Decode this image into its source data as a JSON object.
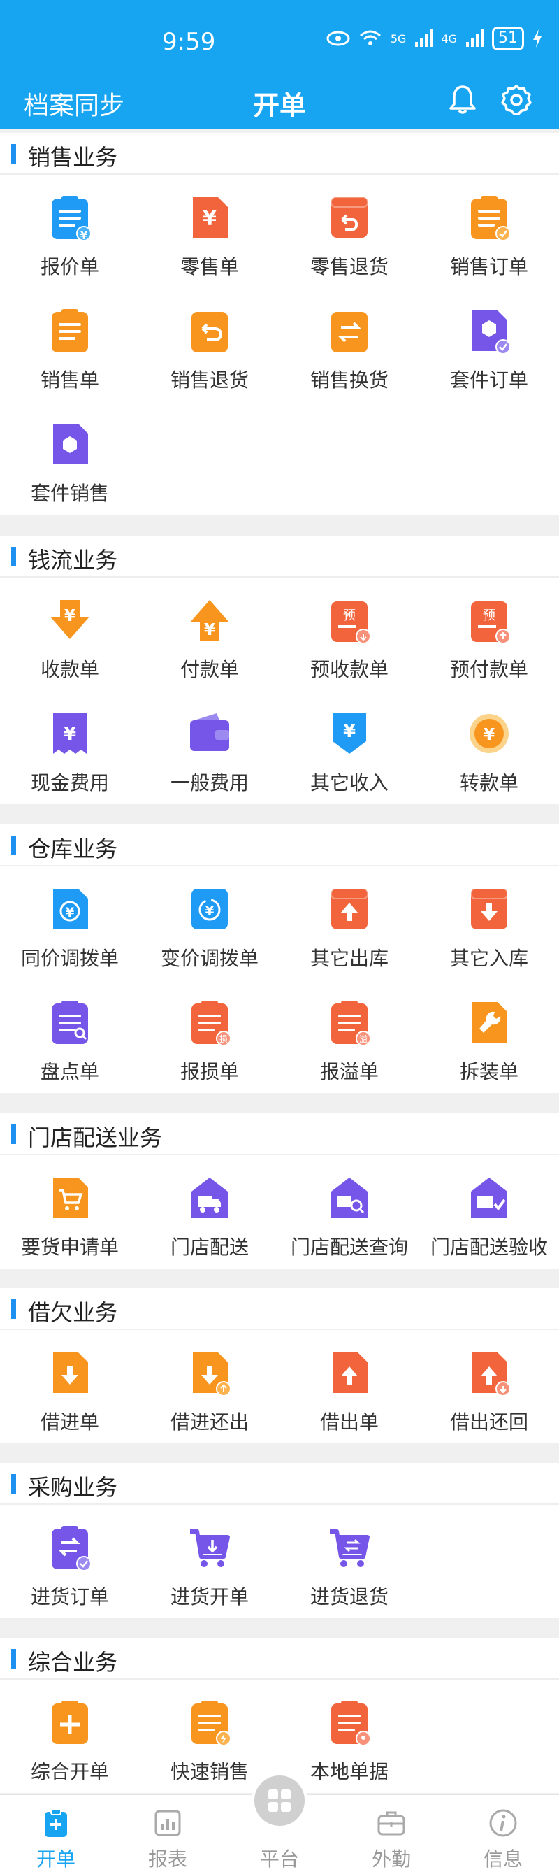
{
  "status": {
    "time": "9:59",
    "battery": "51",
    "net1": "5G",
    "net2": "4G"
  },
  "header": {
    "left_link": "档案同步",
    "title": "开单"
  },
  "colors": {
    "primary": "#17a4f0",
    "orange": "#f7951e",
    "red": "#f2643c",
    "purple": "#7556e8",
    "blue": "#1f9af5"
  },
  "sections": [
    {
      "title": "销售业务",
      "items": [
        {
          "label": "报价单",
          "icon": "quote-doc-icon"
        },
        {
          "label": "零售单",
          "icon": "retail-yen-doc-icon"
        },
        {
          "label": "零售退货",
          "icon": "retail-return-box-icon"
        },
        {
          "label": "销售订单",
          "icon": "sales-order-doc-icon"
        },
        {
          "label": "销售单",
          "icon": "sales-doc-icon"
        },
        {
          "label": "销售退货",
          "icon": "sales-return-icon"
        },
        {
          "label": "销售换货",
          "icon": "sales-exchange-icon"
        },
        {
          "label": "套件订单",
          "icon": "kit-order-icon"
        },
        {
          "label": "套件销售",
          "icon": "kit-sales-icon"
        }
      ]
    },
    {
      "title": "钱流业务",
      "items": [
        {
          "label": "收款单",
          "icon": "receipt-down-arrow-icon"
        },
        {
          "label": "付款单",
          "icon": "payment-up-arrow-icon"
        },
        {
          "label": "预收款单",
          "icon": "advance-receipt-icon"
        },
        {
          "label": "预付款单",
          "icon": "advance-payment-icon"
        },
        {
          "label": "现金费用",
          "icon": "cash-expense-icon"
        },
        {
          "label": "一般费用",
          "icon": "wallet-icon"
        },
        {
          "label": "其它收入",
          "icon": "other-income-icon"
        },
        {
          "label": "转款单",
          "icon": "transfer-coin-icon"
        }
      ]
    },
    {
      "title": "仓库业务",
      "items": [
        {
          "label": "同价调拨单",
          "icon": "same-price-transfer-icon"
        },
        {
          "label": "变价调拨单",
          "icon": "variable-price-transfer-icon"
        },
        {
          "label": "其它出库",
          "icon": "other-outbound-box-icon"
        },
        {
          "label": "其它入库",
          "icon": "other-inbound-box-icon"
        },
        {
          "label": "盘点单",
          "icon": "stocktake-icon"
        },
        {
          "label": "报损单",
          "icon": "loss-report-icon"
        },
        {
          "label": "报溢单",
          "icon": "overflow-report-icon"
        },
        {
          "label": "拆装单",
          "icon": "wrench-icon"
        }
      ]
    },
    {
      "title": "门店配送业务",
      "items": [
        {
          "label": "要货申请单",
          "icon": "cart-request-icon"
        },
        {
          "label": "门店配送",
          "icon": "store-delivery-truck-icon"
        },
        {
          "label": "门店配送查询",
          "icon": "store-delivery-query-icon"
        },
        {
          "label": "门店配送验收",
          "icon": "store-delivery-check-icon"
        }
      ]
    },
    {
      "title": "借欠业务",
      "items": [
        {
          "label": "借进单",
          "icon": "borrow-in-icon"
        },
        {
          "label": "借进还出",
          "icon": "borrow-in-return-icon"
        },
        {
          "label": "借出单",
          "icon": "lend-out-icon"
        },
        {
          "label": "借出还回",
          "icon": "lend-out-return-icon"
        }
      ]
    },
    {
      "title": "采购业务",
      "items": [
        {
          "label": "进货订单",
          "icon": "purchase-order-icon"
        },
        {
          "label": "进货开单",
          "icon": "purchase-cart-icon"
        },
        {
          "label": "进货退货",
          "icon": "purchase-return-cart-icon"
        }
      ]
    },
    {
      "title": "综合业务",
      "items": [
        {
          "label": "综合开单",
          "icon": "plus-doc-icon"
        },
        {
          "label": "快速销售",
          "icon": "quick-sale-icon"
        },
        {
          "label": "本地单据",
          "icon": "local-doc-icon"
        }
      ]
    }
  ],
  "tabs": [
    {
      "label": "开单",
      "icon": "open-order-icon",
      "active": true
    },
    {
      "label": "报表",
      "icon": "report-chart-icon"
    },
    {
      "label": "平台",
      "icon": "platform-grid-icon"
    },
    {
      "label": "外勤",
      "icon": "briefcase-icon"
    },
    {
      "label": "信息",
      "icon": "info-icon"
    }
  ]
}
